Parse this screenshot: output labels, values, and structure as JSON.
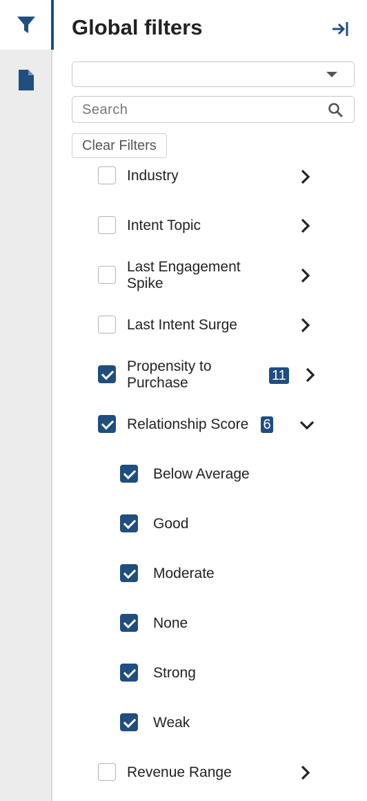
{
  "rail": {
    "items": [
      {
        "icon": "filter-icon",
        "active": true
      },
      {
        "icon": "document-icon",
        "active": false
      }
    ]
  },
  "panel": {
    "title": "Global filters",
    "dropdown_value": "",
    "search_placeholder": "Search",
    "search_value": "",
    "clear_label": "Clear Filters"
  },
  "filters": [
    {
      "label": "Industry",
      "checked": false,
      "expanded": false
    },
    {
      "label": "Intent Topic",
      "checked": false,
      "expanded": false
    },
    {
      "label": "Last Engagement Spike",
      "checked": false,
      "expanded": false
    },
    {
      "label": "Last Intent Surge",
      "checked": false,
      "expanded": false
    },
    {
      "label": "Propensity to Purchase",
      "checked": true,
      "badge": "11",
      "expanded": false
    },
    {
      "label": "Relationship Score",
      "checked": true,
      "badge": "6",
      "expanded": true,
      "options": [
        {
          "label": "Below Average",
          "checked": true
        },
        {
          "label": "Good",
          "checked": true
        },
        {
          "label": "Moderate",
          "checked": true
        },
        {
          "label": "None",
          "checked": true
        },
        {
          "label": "Strong",
          "checked": true
        },
        {
          "label": "Weak",
          "checked": true
        }
      ]
    },
    {
      "label": "Revenue Range",
      "checked": false,
      "expanded": false
    }
  ],
  "colors": {
    "accent": "#1f4e7f",
    "rail_bg": "#ececec",
    "text": "#222222"
  }
}
